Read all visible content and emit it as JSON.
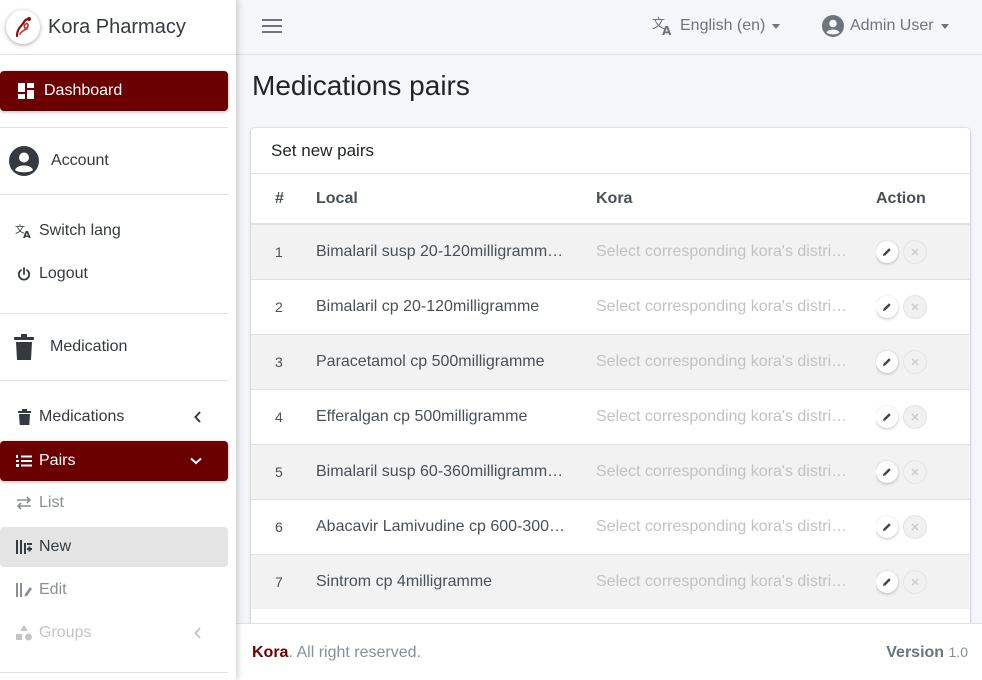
{
  "brand": {
    "name": "Kora Pharmacy"
  },
  "colors": {
    "accent": "#6b0000",
    "background": "#f4f6f9"
  },
  "sidebar": {
    "dashboard": "Dashboard",
    "account": "Account",
    "switch_lang": "Switch lang",
    "logout": "Logout",
    "medication": "Medication",
    "medications": "Medications",
    "pairs": "Pairs",
    "list": "List",
    "new": "New",
    "edit": "Edit",
    "groups": "Groups"
  },
  "topbar": {
    "language": "English (en)",
    "user": "Admin User"
  },
  "page": {
    "title": "Medications pairs"
  },
  "card": {
    "title": "Set new pairs",
    "columns": [
      "#",
      "Local",
      "Kora",
      "Action"
    ],
    "kora_placeholder": "Select corresponding kora's distri…",
    "rows": [
      {
        "num": "1",
        "local": "Bimalaril susp 20-120milligramm…"
      },
      {
        "num": "2",
        "local": "Bimalaril cp 20-120milligramme"
      },
      {
        "num": "3",
        "local": "Paracetamol cp 500milligramme"
      },
      {
        "num": "4",
        "local": "Efferalgan cp 500milligramme"
      },
      {
        "num": "5",
        "local": "Bimalaril susp 60-360milligramm…"
      },
      {
        "num": "6",
        "local": "Abacavir Lamivudine cp 600-300…"
      },
      {
        "num": "7",
        "local": "Sintrom cp 4milligramme"
      }
    ]
  },
  "footer": {
    "brand": "Kora",
    "rights": ". All right reserved.",
    "version_label": "Version",
    "version_number": "1.0"
  }
}
